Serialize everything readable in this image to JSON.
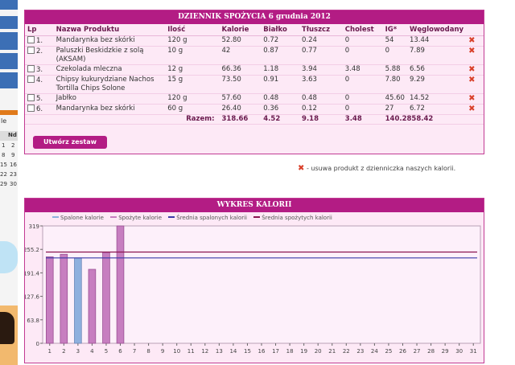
{
  "diary": {
    "title": "DZIENNIK SPOŻYCIA 6 grudnia 2012",
    "columns": [
      "Lp",
      "Nazwa Produktu",
      "Ilość",
      "Kalorie",
      "Białko",
      "Tłuszcz",
      "Cholest",
      "IG*",
      "Węglowodany"
    ],
    "rows": [
      {
        "lp": "1.",
        "name": "Mandarynka bez skórki",
        "qty": "120 g",
        "kcal": "52.80",
        "protein": "0.72",
        "fat": "0.24",
        "chol": "0",
        "ig": "54",
        "carbs": "13.44"
      },
      {
        "lp": "2.",
        "name": "Paluszki Beskidzkie z solą (AKSAM)",
        "qty": "10 g",
        "kcal": "42",
        "protein": "0.87",
        "fat": "0.77",
        "chol": "0",
        "ig": "0",
        "carbs": "7.89"
      },
      {
        "lp": "3.",
        "name": "Czekolada mleczna",
        "qty": "12 g",
        "kcal": "66.36",
        "protein": "1.18",
        "fat": "3.94",
        "chol": "3.48",
        "ig": "5.88",
        "carbs": "6.56"
      },
      {
        "lp": "4.",
        "name": "Chipsy kukurydziane Nachos Tortilla Chips Solone",
        "qty": "15 g",
        "kcal": "73.50",
        "protein": "0.91",
        "fat": "3.63",
        "chol": "0",
        "ig": "7.80",
        "carbs": "9.29"
      },
      {
        "lp": "5.",
        "name": "Jabłko",
        "qty": "120 g",
        "kcal": "57.60",
        "protein": "0.48",
        "fat": "0.48",
        "chol": "0",
        "ig": "45.60",
        "carbs": "14.52"
      },
      {
        "lp": "6.",
        "name": "Mandarynka bez skórki",
        "qty": "60 g",
        "kcal": "26.40",
        "protein": "0.36",
        "fat": "0.12",
        "chol": "0",
        "ig": "27",
        "carbs": "6.72"
      }
    ],
    "totals_label": "Razem:",
    "totals": {
      "kcal": "318.66",
      "protein": "4.52",
      "fat": "9.18",
      "chol": "3.48",
      "ig_carbs": "140.2858.42"
    },
    "create_set_button": "Utwórz zestaw",
    "delete_icon": "x-mark-icon",
    "delete_note": "- usuwa produkt z dzienniczka naszych kalorii."
  },
  "left_calendar": {
    "header": "Nd",
    "cells": [
      "1",
      "2",
      "8",
      "9",
      "15",
      "16",
      "22",
      "23",
      "29",
      "30"
    ]
  },
  "left_strip": {
    "items": [
      "w",
      "le"
    ]
  },
  "chart_data": {
    "type": "bar",
    "title": "WYKRES KALORII",
    "legend": [
      "Spalone kalorie",
      "Spożyte kalorie",
      "Średnia spalonych kalorii",
      "Średnia spożytych kalorii"
    ],
    "x": [
      "1",
      "2",
      "3",
      "4",
      "5",
      "6",
      "7",
      "8",
      "9",
      "10",
      "11",
      "12",
      "13",
      "14",
      "15",
      "16",
      "17",
      "18",
      "19",
      "20",
      "21",
      "22",
      "23",
      "24",
      "25",
      "26",
      "27",
      "28",
      "29",
      "30",
      "31"
    ],
    "series": [
      {
        "name": "Spalone kalorie",
        "values": [
          0,
          0,
          232,
          0,
          0,
          0,
          0,
          0,
          0,
          0,
          0,
          0,
          0,
          0,
          0,
          0,
          0,
          0,
          0,
          0,
          0,
          0,
          0,
          0,
          0,
          0,
          0,
          0,
          0,
          0,
          0
        ]
      },
      {
        "name": "Spożyte kalorie",
        "values": [
          235,
          242,
          0,
          201,
          247,
          319,
          0,
          0,
          0,
          0,
          0,
          0,
          0,
          0,
          0,
          0,
          0,
          0,
          0,
          0,
          0,
          0,
          0,
          0,
          0,
          0,
          0,
          0,
          0,
          0,
          0
        ]
      }
    ],
    "averages": {
      "burned": 232,
      "consumed": 248
    },
    "yticks": [
      "0",
      "63.8",
      "127.6",
      "191.4",
      "255.2",
      "319"
    ],
    "ylim": [
      0,
      319
    ],
    "colors": {
      "burned": "#8eb0de",
      "consumed": "#c77ec0",
      "avg_burned": "#3a3aa8",
      "avg_consumed": "#8a1550"
    }
  }
}
